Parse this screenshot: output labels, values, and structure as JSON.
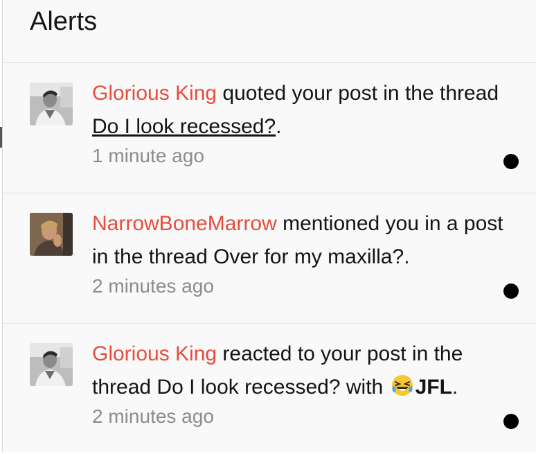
{
  "header": {
    "title": "Alerts"
  },
  "alerts": [
    {
      "user": "Glorious King",
      "text_before": " quoted your post in the thread ",
      "thread": "Do I look recessed?",
      "text_after": ".",
      "time": "1 minute ago",
      "avatar_icon": "user-avatar"
    },
    {
      "user": "NarrowBoneMarrow",
      "text_before": " mentioned you in a post in the thread ",
      "thread": "Over for my maxilla?",
      "text_after": ".",
      "time": "2 minutes ago",
      "avatar_icon": "user-avatar"
    },
    {
      "user": "Glorious King",
      "text_before": " reacted to your post in the thread ",
      "thread": "Do I look recessed?",
      "text_mid": " with ",
      "reaction_icon": "crying-laughing-emoji",
      "reaction": "JFL",
      "text_after": ".",
      "time": "2 minutes ago",
      "avatar_icon": "user-avatar"
    }
  ],
  "colors": {
    "username": "#e74c3c",
    "unread_dot": "#000000",
    "timestamp": "#8c8c8c",
    "panel_bg": "#f9f9f9"
  }
}
